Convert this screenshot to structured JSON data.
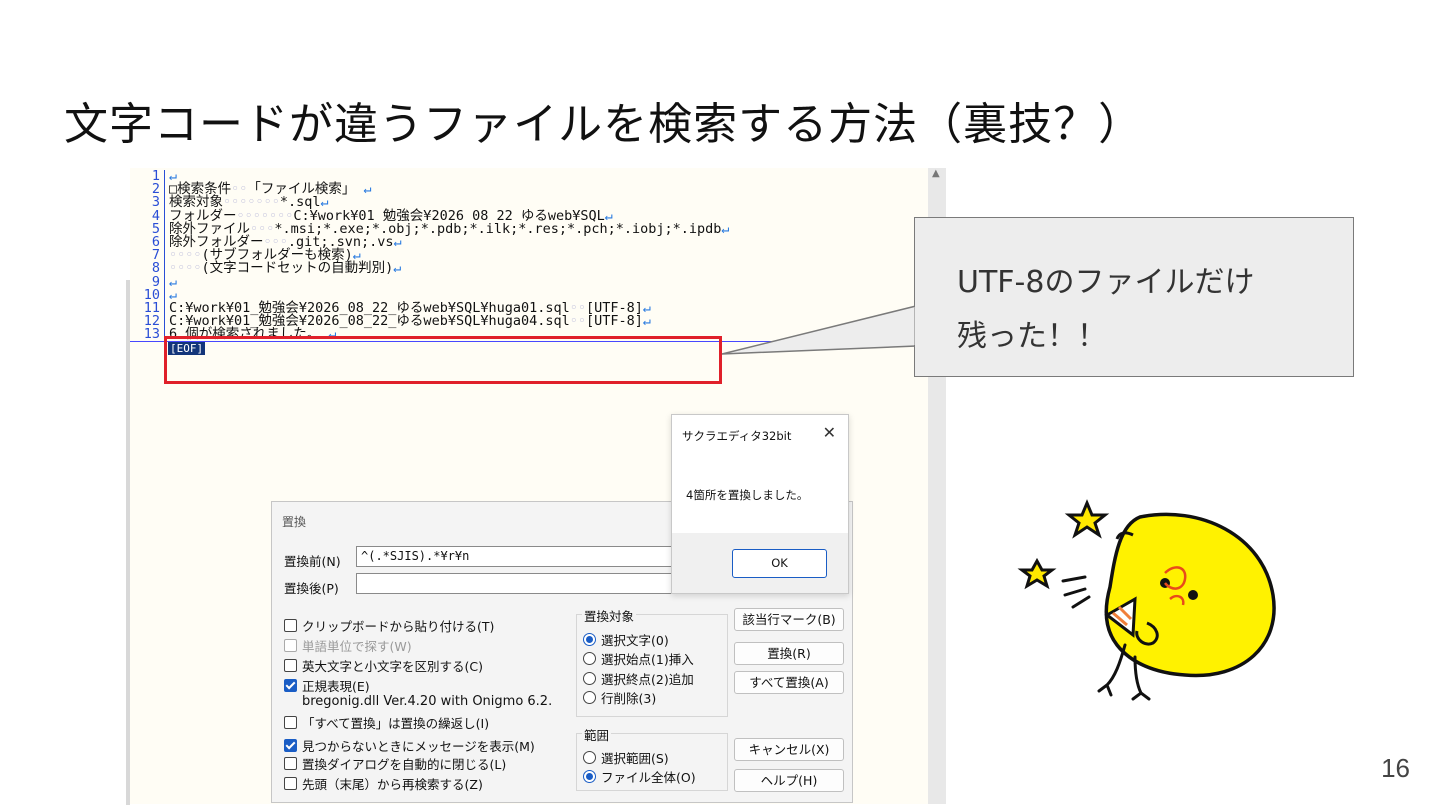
{
  "slide": {
    "title": "文字コードが違うファイルを検索する方法（裏技？）",
    "page_number": "16"
  },
  "editor": {
    "eol_mark": "↵",
    "lines": [
      {
        "n": "1",
        "parts": []
      },
      {
        "n": "2",
        "parts": [
          {
            "t": "□検索条件"
          },
          {
            "t": "◦◦",
            "ws": true
          },
          {
            "t": "「ファイル検索」 "
          }
        ]
      },
      {
        "n": "3",
        "parts": [
          {
            "t": "検索対象"
          },
          {
            "t": "◦◦◦◦◦◦◦",
            "ws": true
          },
          {
            "t": "*.sql"
          }
        ]
      },
      {
        "n": "4",
        "parts": [
          {
            "t": "フォルダー"
          },
          {
            "t": "◦◦◦◦◦◦◦",
            "ws": true
          },
          {
            "t": "C:¥work¥01 勉強会¥2026 08 22 ゆるweb¥SQL"
          }
        ]
      },
      {
        "n": "5",
        "parts": [
          {
            "t": "除外ファイル"
          },
          {
            "t": "◦◦◦",
            "ws": true
          },
          {
            "t": "*.msi;*.exe;*.obj;*.pdb;*.ilk;*.res;*.pch;*.iobj;*.ipdb"
          }
        ]
      },
      {
        "n": "6",
        "parts": [
          {
            "t": "除外フォルダー"
          },
          {
            "t": "◦◦◦",
            "ws": true
          },
          {
            "t": ".git;.svn;.vs"
          }
        ]
      },
      {
        "n": "7",
        "parts": [
          {
            "t": "◦◦◦◦",
            "ws": true
          },
          {
            "t": "(サブフォルダーも検索)"
          }
        ]
      },
      {
        "n": "8",
        "parts": [
          {
            "t": "◦◦◦◦",
            "ws": true
          },
          {
            "t": "(文字コードセットの自動判別)"
          }
        ]
      },
      {
        "n": "9",
        "parts": []
      },
      {
        "n": "10",
        "parts": []
      },
      {
        "n": "11",
        "parts": [
          {
            "t": "C:¥work¥01_勉強会¥2026_08_22_ゆるweb¥SQL¥huga01.sql"
          },
          {
            "t": "◦◦",
            "ws": true
          },
          {
            "t": "[UTF-8]"
          }
        ]
      },
      {
        "n": "12",
        "parts": [
          {
            "t": "C:¥work¥01_勉強会¥2026_08_22_ゆるweb¥SQL¥huga04.sql"
          },
          {
            "t": "◦◦",
            "ws": true
          },
          {
            "t": "[UTF-8]"
          }
        ]
      },
      {
        "n": "13",
        "parts": [
          {
            "t": "6 個が検索されました。 "
          }
        ],
        "current": true
      }
    ],
    "eof_label": "[EOF]"
  },
  "replace_dialog": {
    "title": "置換",
    "find_label": "置換前(N)",
    "find_value": "^(.*SJIS).*¥r¥n",
    "replace_label": "置換後(P)",
    "replace_value": "",
    "options": [
      {
        "label": "クリップボードから貼り付ける(T)",
        "checked": false,
        "disabled": false
      },
      {
        "label": "単語単位で探す(W)",
        "checked": false,
        "disabled": true
      },
      {
        "label": "英大文字と小文字を区別する(C)",
        "checked": false,
        "disabled": false
      },
      {
        "label": "正規表現(E)",
        "checked": true,
        "disabled": false
      }
    ],
    "regex_lib": "bregonig.dll Ver.4.20 with Onigmo 6.2.0",
    "options2": [
      {
        "label": "「すべて置換」は置換の繰返し(I)",
        "checked": false
      },
      {
        "label": "見つからないときにメッセージを表示(M)",
        "checked": true
      },
      {
        "label": "置換ダイアログを自動的に閉じる(L)",
        "checked": false
      },
      {
        "label": "先頭（末尾）から再検索する(Z)",
        "checked": false
      }
    ],
    "target_group": {
      "label": "置換対象",
      "items": [
        {
          "label": "選択文字(0)",
          "selected": true
        },
        {
          "label": "選択始点(1)挿入",
          "selected": false
        },
        {
          "label": "選択終点(2)追加",
          "selected": false
        },
        {
          "label": "行削除(3)",
          "selected": false
        }
      ]
    },
    "range_group": {
      "label": "範囲",
      "items": [
        {
          "label": "選択範囲(S)",
          "selected": false
        },
        {
          "label": "ファイル全体(O)",
          "selected": true
        }
      ]
    },
    "buttons": {
      "mark": "該当行マーク(B)",
      "replace": "置換(R)",
      "replace_all": "すべて置換(A)",
      "cancel": "キャンセル(X)",
      "help": "ヘルプ(H)"
    }
  },
  "message_box": {
    "title": "サクラエディタ32bit",
    "close": "✕",
    "message": "4箇所を置換しました。",
    "ok": "OK"
  },
  "callout": {
    "line1": "UTF-8のファイルだけ",
    "line2": "残った！！"
  },
  "colors": {
    "highlight_border": "#e0202a",
    "line_number": "#2a4ed6",
    "check_accent": "#1a5dc5"
  }
}
